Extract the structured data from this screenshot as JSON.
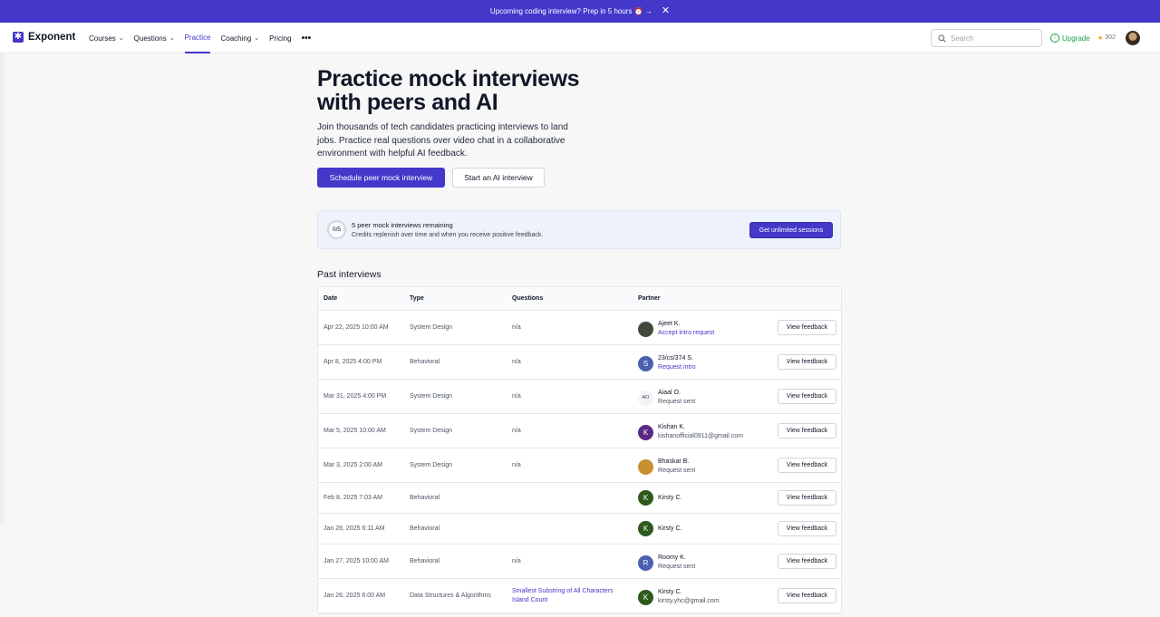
{
  "banner": {
    "text": "Upcoming coding interview? Prep in 5 hours ⏰ →",
    "close": "✕"
  },
  "nav": {
    "logo_text": "Exponent",
    "links": [
      {
        "label": "Courses",
        "has_menu": true
      },
      {
        "label": "Questions",
        "has_menu": true
      },
      {
        "label": "Practice",
        "active": true
      },
      {
        "label": "Coaching",
        "has_menu": true
      },
      {
        "label": "Pricing"
      }
    ],
    "more": "•••",
    "search_placeholder": "Search",
    "upgrade": "Upgrade",
    "points": "302"
  },
  "hero": {
    "title": "Practice mock interviews with peers and AI",
    "description": "Join thousands of tech candidates practicing interviews to land jobs. Practice real questions over video chat in a collaborative environment with helpful AI feedback.",
    "primary_button": "Schedule peer mock interview",
    "secondary_button": "Start an AI interview"
  },
  "credits": {
    "ring": "0/5",
    "progress_fraction": 0,
    "title": "5 peer mock interviews remaining",
    "subtitle": "Credits replenish over time and when you receive positive feedback.",
    "button": "Get unlimited sessions"
  },
  "past": {
    "title": "Past interviews",
    "headers": {
      "date": "Date",
      "type": "Type",
      "questions": "Questions",
      "partner": "Partner"
    },
    "feedback_label": "View feedback",
    "rows": [
      {
        "date": "Apr 22, 2025 10:00 AM",
        "type": "System Design",
        "q1": "n/a",
        "q2": "",
        "initial": "",
        "avatar_color": "#3f4a3c",
        "name": "Ajeet K.",
        "sub": "Accept intro request",
        "sub_link": true
      },
      {
        "date": "Apr 8, 2025 4:00 PM",
        "type": "Behavioral",
        "q1": "n/a",
        "q2": "",
        "initial": "S",
        "avatar_color": "#4c5fb0",
        "name": "23/cs/374 S.",
        "sub": "Request intro",
        "sub_link": true
      },
      {
        "date": "Mar 31, 2025 4:00 PM",
        "type": "System Design",
        "q1": "n/a",
        "q2": "",
        "initial": "AO",
        "avatar_color": "#f3f4f6",
        "name": "Aiaal O.",
        "sub": "Request sent",
        "sub_link": false
      },
      {
        "date": "Mar 5, 2025 10:00 AM",
        "type": "System Design",
        "q1": "n/a",
        "q2": "",
        "initial": "K",
        "avatar_color": "#5b2a86",
        "name": "Kishan K.",
        "sub": "kishanofficial0911@gmail.com",
        "sub_link": false
      },
      {
        "date": "Mar 3, 2025 2:00 AM",
        "type": "System Design",
        "q1": "n/a",
        "q2": "",
        "initial": "",
        "avatar_color": "#c8902e",
        "name": "Bhaskar B.",
        "sub": "Request sent",
        "sub_link": false
      },
      {
        "date": "Feb 8, 2025 7:03 AM",
        "type": "Behavioral",
        "q1": "",
        "q2": "",
        "initial": "K",
        "avatar_color": "#2f5a1e",
        "name": "Kirsty C.",
        "sub": "",
        "sub_link": false
      },
      {
        "date": "Jan 28, 2025 6:11 AM",
        "type": "Behavioral",
        "q1": "",
        "q2": "",
        "initial": "K",
        "avatar_color": "#2f5a1e",
        "name": "Kirsty C.",
        "sub": "",
        "sub_link": false
      },
      {
        "date": "Jan 27, 2025 10:00 AM",
        "type": "Behavioral",
        "q1": "n/a",
        "q2": "",
        "initial": "R",
        "avatar_color": "#4c5fb0",
        "name": "Roomy K.",
        "sub": "Request sent",
        "sub_link": false
      },
      {
        "date": "Jan 26, 2025 6:00 AM",
        "type": "Data Structures & Algorithms",
        "q1": "Smallest Substring of All Characters",
        "q2": "Island Count",
        "q_link": true,
        "initial": "K",
        "avatar_color": "#2f5a1e",
        "name": "Kirsty C.",
        "sub": "kirsty.yhc@gmail.com",
        "sub_link": false
      }
    ]
  }
}
